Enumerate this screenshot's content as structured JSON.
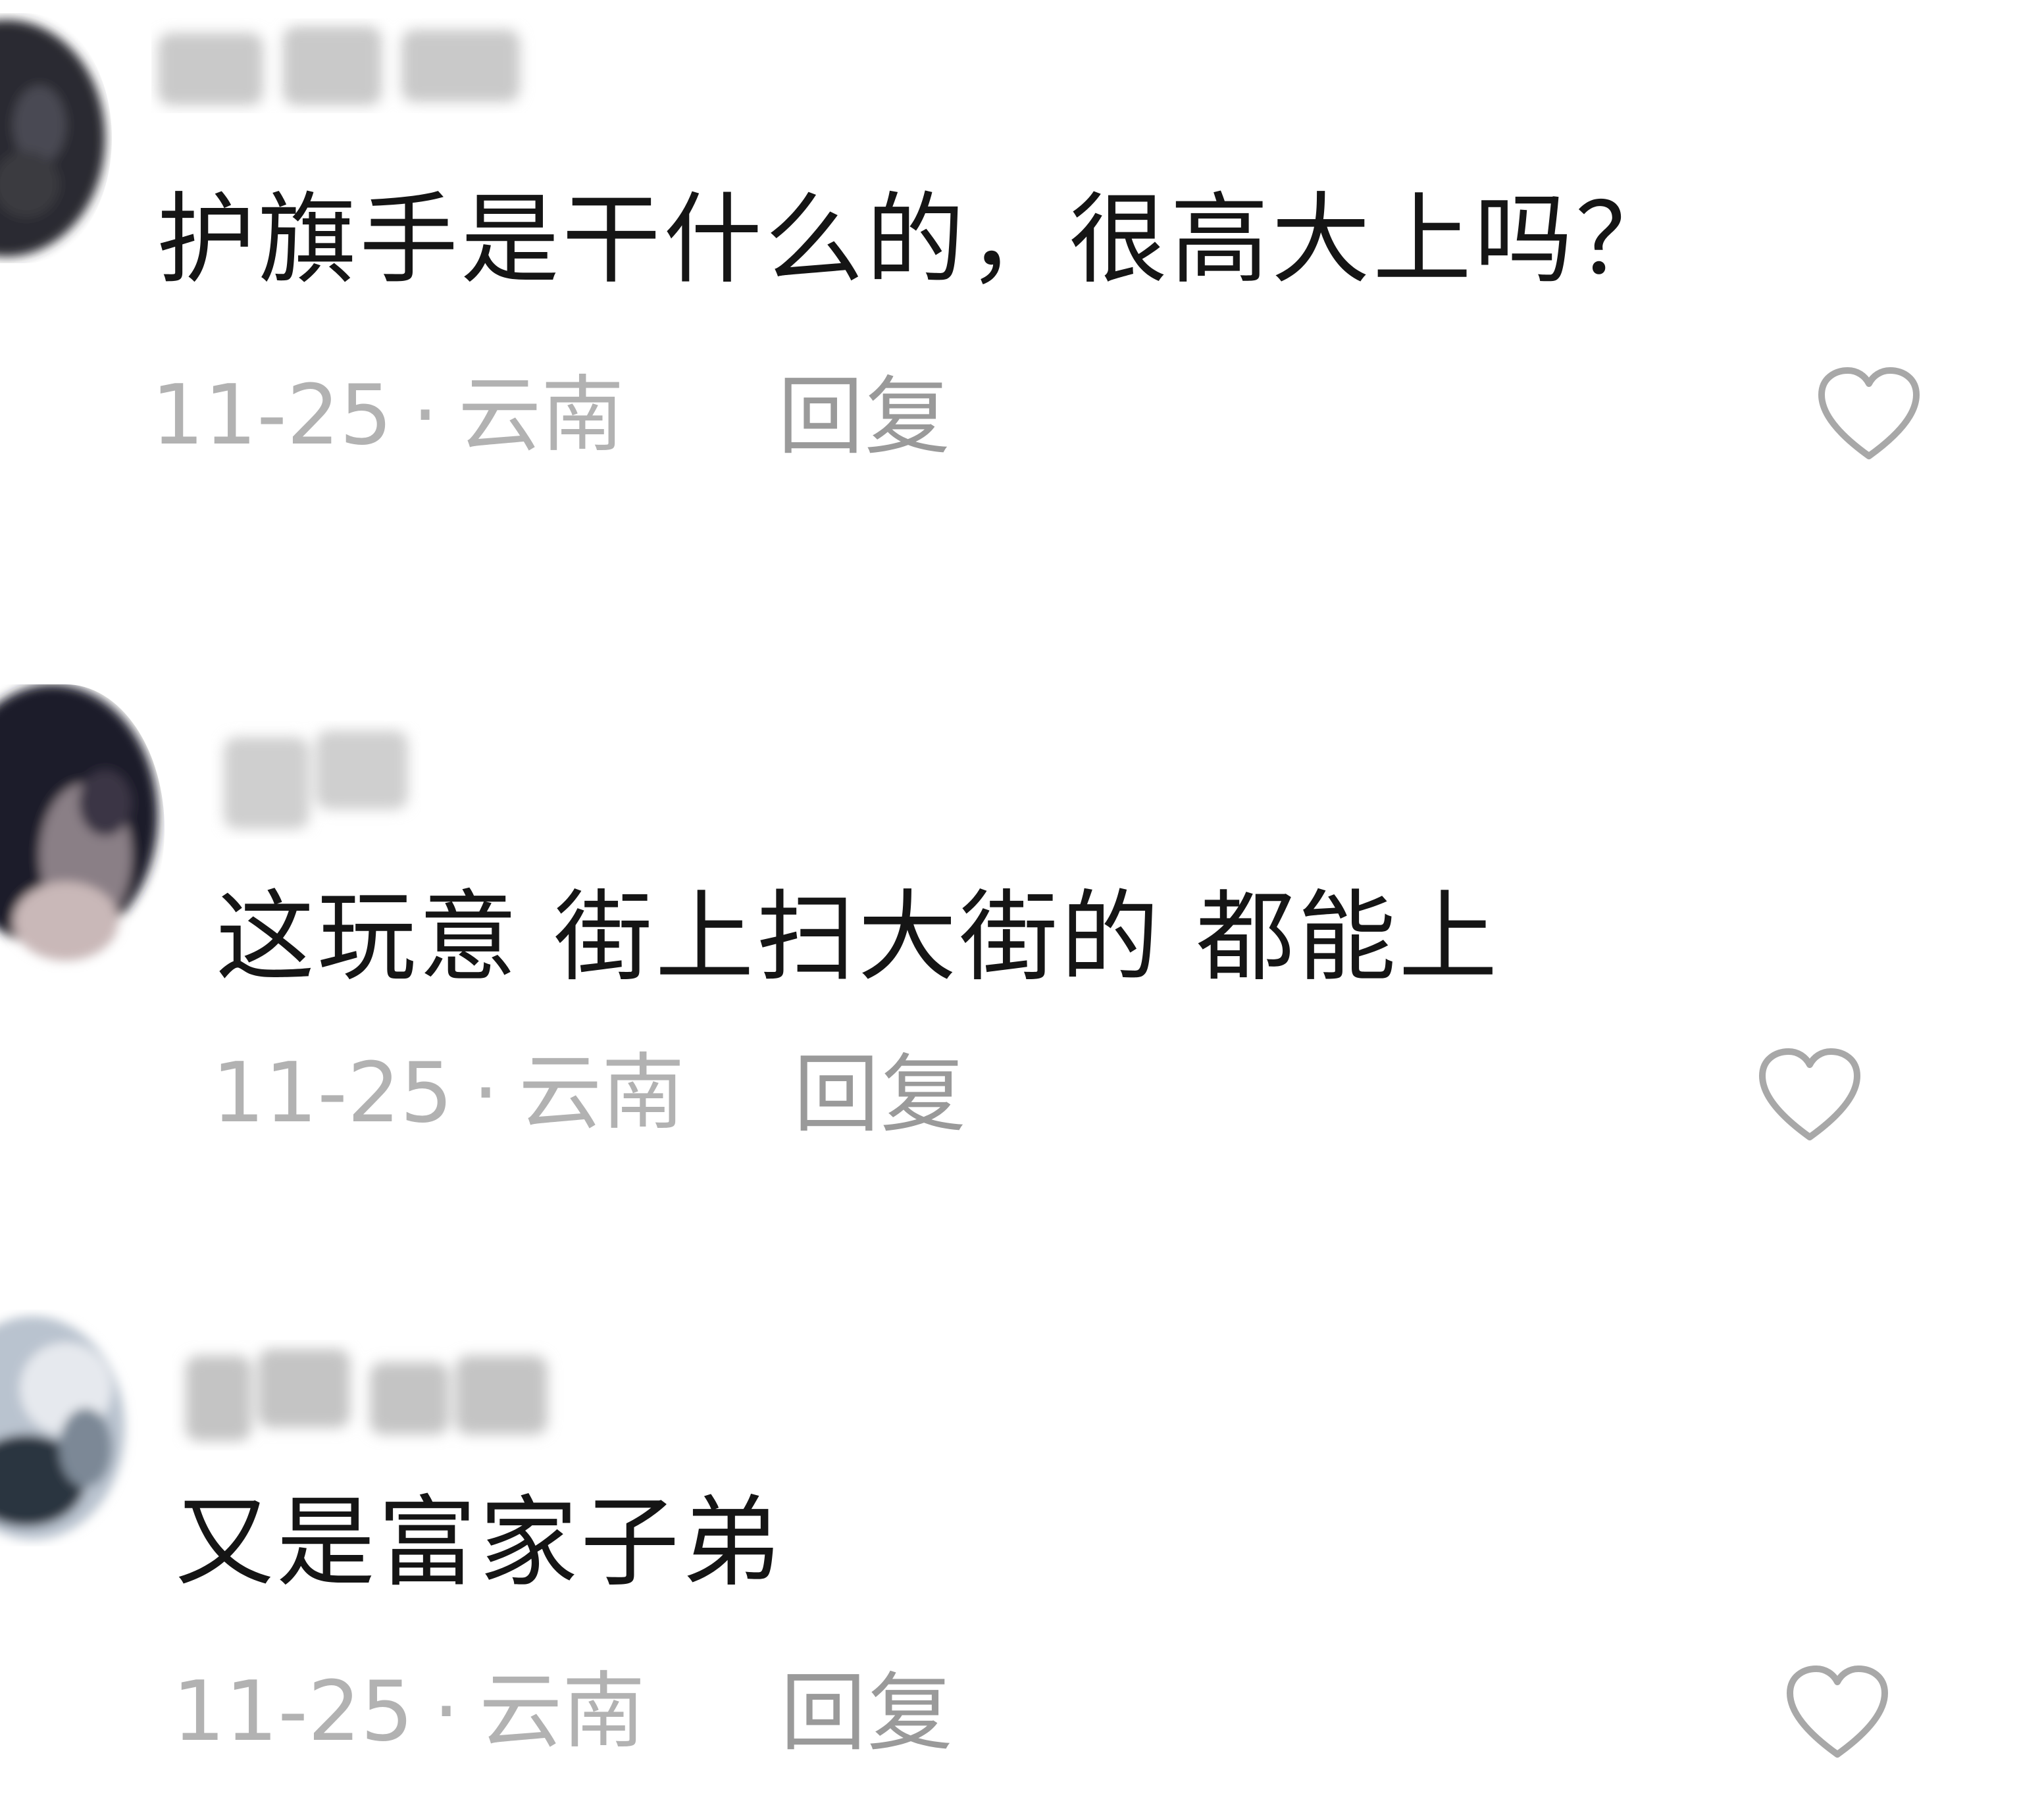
{
  "comments": [
    {
      "text": "护旗手是干什么的，很高大上吗？",
      "date": "11-25",
      "separator": "·",
      "location": "云南",
      "reply_label": "回复",
      "like_icon": "heart-outline-icon"
    },
    {
      "text": "这玩意 街上扫大街的 都能上",
      "date": "11-25",
      "separator": "·",
      "location": "云南",
      "reply_label": "回复",
      "like_icon": "heart-outline-icon"
    },
    {
      "text": "又是富家子弟",
      "date": "11-25",
      "separator": "·",
      "location": "云南",
      "reply_label": "回复",
      "like_icon": "heart-outline-icon"
    }
  ],
  "colors": {
    "text": "#151515",
    "meta": "#b2b2b2",
    "reply": "#9a9a9a",
    "heart": "#a8a8a8",
    "background": "#ffffff"
  }
}
